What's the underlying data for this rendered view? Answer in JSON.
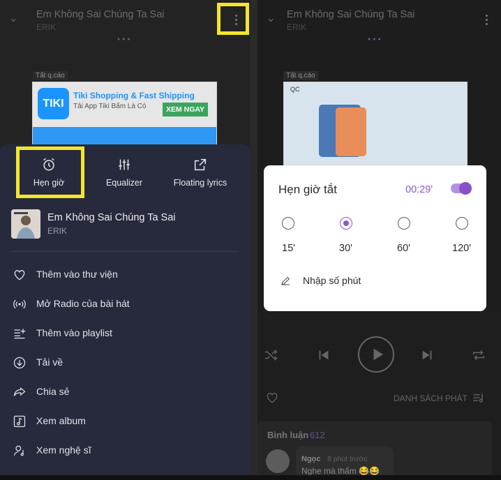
{
  "colors": {
    "accent": "#8d59c8",
    "highlight": "#f3e62a",
    "sheet_bg": "#272a3c",
    "ad_button": "#3ba55d",
    "tiki_blue": "#1a94ff"
  },
  "left": {
    "header": {
      "title": "Em Không Sai Chúng Ta Sai",
      "artist": "ERIK"
    },
    "ad": {
      "tag": "Tất q.cáo",
      "logo": "TIKI",
      "title": "Tiki Shopping & Fast Shipping",
      "subtitle": "Tải App Tiki Bấm Là Có",
      "button": "XEM NGAY"
    },
    "sheet": {
      "actions": [
        {
          "label": "Hẹn giờ",
          "icon": "alarm-clock-icon"
        },
        {
          "label": "Equalizer",
          "icon": "equalizer-icon"
        },
        {
          "label": "Floating lyrics",
          "icon": "external-link-icon"
        }
      ],
      "song": {
        "title": "Em Không Sai Chúng Ta Sai",
        "artist": "ERIK"
      },
      "menu": [
        {
          "label": "Thêm vào thư viện",
          "icon": "heart-icon"
        },
        {
          "label": "Mở Radio của bài hát",
          "icon": "radio-icon"
        },
        {
          "label": "Thêm vào playlist",
          "icon": "playlist-add-icon"
        },
        {
          "label": "Tải về",
          "icon": "download-icon"
        },
        {
          "label": "Chia sẻ",
          "icon": "share-icon"
        },
        {
          "label": "Xem album",
          "icon": "album-icon"
        },
        {
          "label": "Xem nghệ sĩ",
          "icon": "artist-icon"
        }
      ]
    }
  },
  "right": {
    "header": {
      "title": "Em Không Sai Chúng Ta Sai",
      "artist": "ERIK"
    },
    "ad": {
      "tag": "Tất q.cáo",
      "label": "QC"
    },
    "playlist_label": "DANH SÁCH PHÁT",
    "comments": {
      "title": "Bình luận",
      "count": "612",
      "user": "Ngọc",
      "time": "8 phút trước",
      "text": "Nghe mà thấm 😂😂"
    }
  },
  "popup": {
    "title": "Hẹn giờ tắt",
    "time": "00:29'",
    "enabled": true,
    "options": [
      {
        "label": "15'",
        "selected": false
      },
      {
        "label": "30'",
        "selected": true
      },
      {
        "label": "60'",
        "selected": false
      },
      {
        "label": "120'",
        "selected": false
      }
    ],
    "manual_input": "Nhập số phút"
  }
}
